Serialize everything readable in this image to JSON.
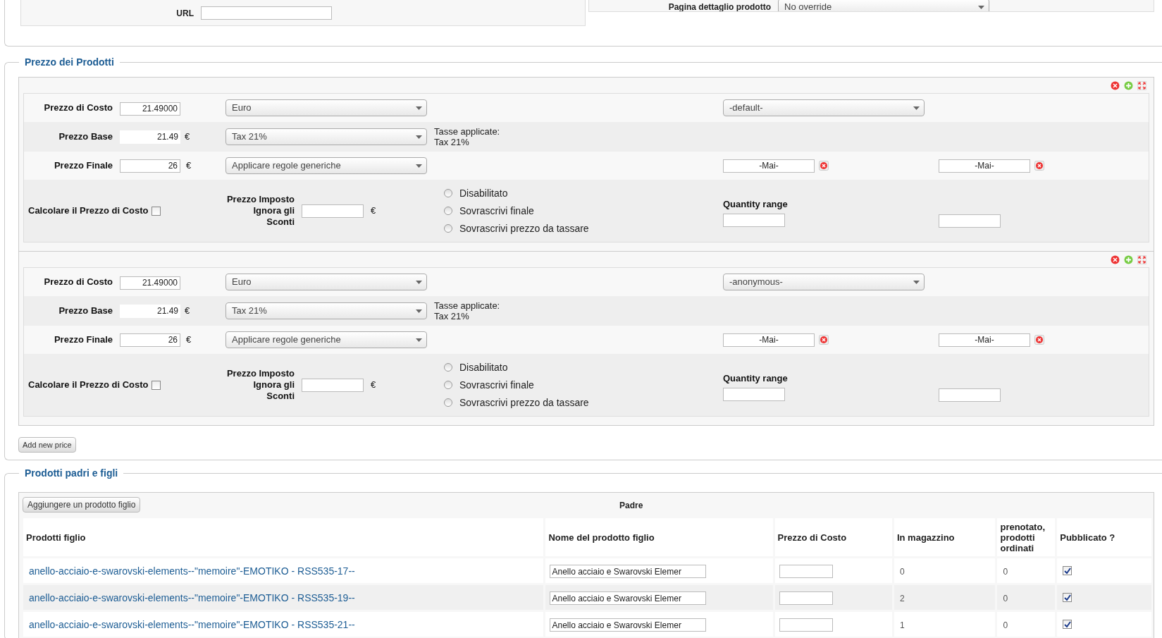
{
  "top": {
    "url_label": "URL",
    "page_label": "Pagina dettaglio prodotto",
    "page_select": "No override"
  },
  "prices": {
    "legend": "Prezzo dei Prodotti",
    "add_button": "Add new price",
    "blocks": [
      {
        "cost_label": "Prezzo di Costo",
        "cost_value": "21.49000",
        "currency": "Euro",
        "shopper_group": "-default-",
        "base_label": "Prezzo Base",
        "base_value": "21.49",
        "base_symbol": "€",
        "tax": "Tax 21%",
        "taxes_label": "Tasse applicate:",
        "taxes_value": "Tax 21%",
        "final_label": "Prezzo Finale",
        "final_value": "26",
        "final_symbol": "€",
        "rule": "Applicare regole generiche",
        "date_from": "-Mai-",
        "date_to": "-Mai-",
        "calc_label": "Calcolare il Prezzo di Costo",
        "calc_checked": false,
        "override_label": "Prezzo Imposto Ignora gli Sconti",
        "override_symbol": "€",
        "override_options": [
          {
            "label": "Disabilitato",
            "selected": false
          },
          {
            "label": "Sovrascrivi finale",
            "selected": false
          },
          {
            "label": "Sovrascrivi prezzo da tassare",
            "selected": false
          }
        ],
        "quantity_label": "Quantity range"
      },
      {
        "cost_label": "Prezzo di Costo",
        "cost_value": "21.49000",
        "currency": "Euro",
        "shopper_group": "-anonymous-",
        "base_label": "Prezzo Base",
        "base_value": "21.49",
        "base_symbol": "€",
        "tax": "Tax 21%",
        "taxes_label": "Tasse applicate:",
        "taxes_value": "Tax 21%",
        "final_label": "Prezzo Finale",
        "final_value": "26",
        "final_symbol": "€",
        "rule": "Applicare regole generiche",
        "date_from": "-Mai-",
        "date_to": "-Mai-",
        "calc_label": "Calcolare il Prezzo di Costo",
        "calc_checked": false,
        "override_label": "Prezzo Imposto Ignora gli Sconti",
        "override_symbol": "€",
        "override_options": [
          {
            "label": "Disabilitato",
            "selected": false
          },
          {
            "label": "Sovrascrivi finale",
            "selected": false
          },
          {
            "label": "Sovrascrivi prezzo da tassare",
            "selected": false
          }
        ],
        "quantity_label": "Quantity range"
      }
    ]
  },
  "children": {
    "legend": "Prodotti padri e figli",
    "add_button": "Aggiungere un prodotto figlio",
    "parent_label": "Padre",
    "table": {
      "columns": [
        "Prodotti figlio",
        "Nome del prodotto figlio",
        "Prezzo di Costo",
        "In magazzino",
        "prenotato, prodotti ordinati",
        "Pubblicato ?"
      ],
      "rows": [
        {
          "link": "anello-acciaio-e-swarovski-elements--\"memoire\"-EMOTIKO - RSS535-17--",
          "name": "Anello acciaio e Swarovski Elemer",
          "stock": "0",
          "ordered": "0",
          "published": true
        },
        {
          "link": "anello-acciaio-e-swarovski-elements--\"memoire\"-EMOTIKO - RSS535-19--",
          "name": "Anello acciaio e Swarovski Elemer",
          "stock": "2",
          "ordered": "0",
          "published": true
        },
        {
          "link": "anello-acciaio-e-swarovski-elements--\"memoire\"-EMOTIKO - RSS535-21--",
          "name": "Anello acciaio e Swarovski Elemer",
          "stock": "1",
          "ordered": "0",
          "published": true
        }
      ]
    }
  }
}
